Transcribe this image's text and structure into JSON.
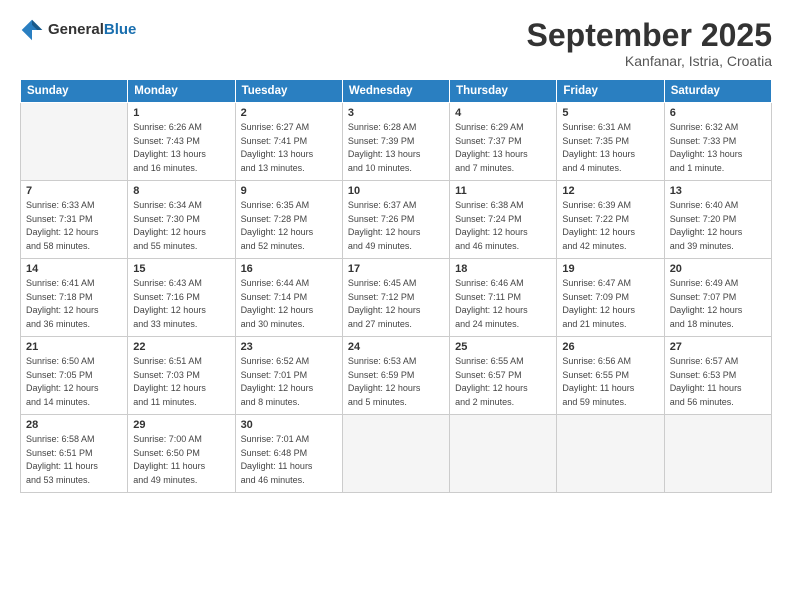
{
  "header": {
    "logo_general": "General",
    "logo_blue": "Blue",
    "month_title": "September 2025",
    "location": "Kanfanar, Istria, Croatia"
  },
  "days_of_week": [
    "Sunday",
    "Monday",
    "Tuesday",
    "Wednesday",
    "Thursday",
    "Friday",
    "Saturday"
  ],
  "weeks": [
    [
      {
        "day": "",
        "info": ""
      },
      {
        "day": "1",
        "info": "Sunrise: 6:26 AM\nSunset: 7:43 PM\nDaylight: 13 hours\nand 16 minutes."
      },
      {
        "day": "2",
        "info": "Sunrise: 6:27 AM\nSunset: 7:41 PM\nDaylight: 13 hours\nand 13 minutes."
      },
      {
        "day": "3",
        "info": "Sunrise: 6:28 AM\nSunset: 7:39 PM\nDaylight: 13 hours\nand 10 minutes."
      },
      {
        "day": "4",
        "info": "Sunrise: 6:29 AM\nSunset: 7:37 PM\nDaylight: 13 hours\nand 7 minutes."
      },
      {
        "day": "5",
        "info": "Sunrise: 6:31 AM\nSunset: 7:35 PM\nDaylight: 13 hours\nand 4 minutes."
      },
      {
        "day": "6",
        "info": "Sunrise: 6:32 AM\nSunset: 7:33 PM\nDaylight: 13 hours\nand 1 minute."
      }
    ],
    [
      {
        "day": "7",
        "info": "Sunrise: 6:33 AM\nSunset: 7:31 PM\nDaylight: 12 hours\nand 58 minutes."
      },
      {
        "day": "8",
        "info": "Sunrise: 6:34 AM\nSunset: 7:30 PM\nDaylight: 12 hours\nand 55 minutes."
      },
      {
        "day": "9",
        "info": "Sunrise: 6:35 AM\nSunset: 7:28 PM\nDaylight: 12 hours\nand 52 minutes."
      },
      {
        "day": "10",
        "info": "Sunrise: 6:37 AM\nSunset: 7:26 PM\nDaylight: 12 hours\nand 49 minutes."
      },
      {
        "day": "11",
        "info": "Sunrise: 6:38 AM\nSunset: 7:24 PM\nDaylight: 12 hours\nand 46 minutes."
      },
      {
        "day": "12",
        "info": "Sunrise: 6:39 AM\nSunset: 7:22 PM\nDaylight: 12 hours\nand 42 minutes."
      },
      {
        "day": "13",
        "info": "Sunrise: 6:40 AM\nSunset: 7:20 PM\nDaylight: 12 hours\nand 39 minutes."
      }
    ],
    [
      {
        "day": "14",
        "info": "Sunrise: 6:41 AM\nSunset: 7:18 PM\nDaylight: 12 hours\nand 36 minutes."
      },
      {
        "day": "15",
        "info": "Sunrise: 6:43 AM\nSunset: 7:16 PM\nDaylight: 12 hours\nand 33 minutes."
      },
      {
        "day": "16",
        "info": "Sunrise: 6:44 AM\nSunset: 7:14 PM\nDaylight: 12 hours\nand 30 minutes."
      },
      {
        "day": "17",
        "info": "Sunrise: 6:45 AM\nSunset: 7:12 PM\nDaylight: 12 hours\nand 27 minutes."
      },
      {
        "day": "18",
        "info": "Sunrise: 6:46 AM\nSunset: 7:11 PM\nDaylight: 12 hours\nand 24 minutes."
      },
      {
        "day": "19",
        "info": "Sunrise: 6:47 AM\nSunset: 7:09 PM\nDaylight: 12 hours\nand 21 minutes."
      },
      {
        "day": "20",
        "info": "Sunrise: 6:49 AM\nSunset: 7:07 PM\nDaylight: 12 hours\nand 18 minutes."
      }
    ],
    [
      {
        "day": "21",
        "info": "Sunrise: 6:50 AM\nSunset: 7:05 PM\nDaylight: 12 hours\nand 14 minutes."
      },
      {
        "day": "22",
        "info": "Sunrise: 6:51 AM\nSunset: 7:03 PM\nDaylight: 12 hours\nand 11 minutes."
      },
      {
        "day": "23",
        "info": "Sunrise: 6:52 AM\nSunset: 7:01 PM\nDaylight: 12 hours\nand 8 minutes."
      },
      {
        "day": "24",
        "info": "Sunrise: 6:53 AM\nSunset: 6:59 PM\nDaylight: 12 hours\nand 5 minutes."
      },
      {
        "day": "25",
        "info": "Sunrise: 6:55 AM\nSunset: 6:57 PM\nDaylight: 12 hours\nand 2 minutes."
      },
      {
        "day": "26",
        "info": "Sunrise: 6:56 AM\nSunset: 6:55 PM\nDaylight: 11 hours\nand 59 minutes."
      },
      {
        "day": "27",
        "info": "Sunrise: 6:57 AM\nSunset: 6:53 PM\nDaylight: 11 hours\nand 56 minutes."
      }
    ],
    [
      {
        "day": "28",
        "info": "Sunrise: 6:58 AM\nSunset: 6:51 PM\nDaylight: 11 hours\nand 53 minutes."
      },
      {
        "day": "29",
        "info": "Sunrise: 7:00 AM\nSunset: 6:50 PM\nDaylight: 11 hours\nand 49 minutes."
      },
      {
        "day": "30",
        "info": "Sunrise: 7:01 AM\nSunset: 6:48 PM\nDaylight: 11 hours\nand 46 minutes."
      },
      {
        "day": "",
        "info": ""
      },
      {
        "day": "",
        "info": ""
      },
      {
        "day": "",
        "info": ""
      },
      {
        "day": "",
        "info": ""
      }
    ]
  ]
}
